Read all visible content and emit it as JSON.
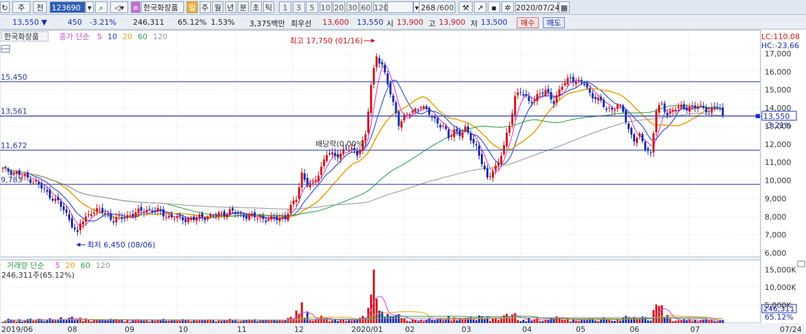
{
  "toolbar": {
    "market": "주",
    "period": "전",
    "code": "123690",
    "stock_name": "한국화장품",
    "periods": [
      "일",
      "주",
      "월",
      "년",
      "분",
      "초",
      "틱"
    ],
    "minutes": [
      "1",
      "3",
      "5",
      "10",
      "20",
      "30",
      "60",
      "120"
    ],
    "count": "268",
    "count_total": "/600",
    "date": "2020/07/24"
  },
  "quote": {
    "price": "13,550",
    "change": "450",
    "change_pct": "-3.21%",
    "volume": "246,311",
    "volume_ratio": "65.12%",
    "turnover": "1.53%",
    "amount": "3,375백만",
    "quote_label": "최우선",
    "ask": "13,600",
    "bid": "13,550",
    "open_label": "시",
    "open": "13,900",
    "high_label": "고",
    "high": "13,900",
    "low_label": "저",
    "low": "13,500",
    "buy_label": "매수",
    "sell_label": "매도"
  },
  "price_panel": {
    "name_tab": "한국화장품",
    "ma_legend": {
      "label": "종가 단순",
      "periods": [
        "5",
        "10",
        "20",
        "60",
        "120"
      ]
    },
    "lc": "LC:110.08",
    "hc": "HC:-23.66",
    "hlines": [
      "15,450",
      "13,561",
      "11,672",
      "9,783"
    ],
    "current_label": "13,550",
    "current_pct": "-3.21%",
    "max_annotation": "최고 17,750 (01/16)",
    "min_annotation": "최저 6,450 (08/06)",
    "dividend_annotation": "배당락(0.00%)"
  },
  "volume_panel": {
    "legend_label": "거래량 단순",
    "legend_periods": [
      "5",
      "20",
      "60",
      "120"
    ],
    "value_label": "246,311주(65.12%)",
    "current_label": "246,311",
    "current_pct": "65.12%"
  },
  "chart_data": {
    "type": "candlestick",
    "x_ticks": [
      "2019/06",
      "08",
      "09",
      "10",
      "11",
      "12",
      "2020/01",
      "02",
      "03",
      "04",
      "05",
      "06",
      "07",
      "07/24"
    ],
    "y_ticks": [
      "6,000",
      "7,000",
      "8,000",
      "9,000",
      "10,000",
      "11,000",
      "12,000",
      "13,000",
      "14,000",
      "15,000",
      "16,000",
      "17,000"
    ],
    "ylim": [
      6000,
      18000
    ],
    "volume_ticks": [
      "5,000K",
      "10,000K",
      "15,000K"
    ],
    "close_anchors": [
      [
        0,
        10600
      ],
      [
        4,
        10450
      ],
      [
        8,
        10200
      ],
      [
        12,
        9900
      ],
      [
        16,
        9300
      ],
      [
        20,
        8800
      ],
      [
        24,
        7900
      ],
      [
        27,
        7000
      ],
      [
        28,
        7600
      ],
      [
        32,
        8300
      ],
      [
        36,
        8300
      ],
      [
        40,
        7800
      ],
      [
        44,
        8000
      ],
      [
        48,
        8200
      ],
      [
        52,
        8400
      ],
      [
        56,
        8300
      ],
      [
        60,
        8000
      ],
      [
        64,
        7900
      ],
      [
        68,
        7850
      ],
      [
        72,
        8000
      ],
      [
        76,
        8050
      ],
      [
        80,
        8200
      ],
      [
        82,
        8300
      ],
      [
        86,
        8100
      ],
      [
        90,
        8000
      ],
      [
        94,
        7900
      ],
      [
        98,
        7850
      ],
      [
        102,
        8000
      ],
      [
        106,
        9000
      ],
      [
        108,
        10400
      ],
      [
        110,
        9800
      ],
      [
        112,
        9700
      ],
      [
        114,
        10400
      ],
      [
        117,
        11500
      ],
      [
        120,
        11300
      ],
      [
        124,
        11800
      ],
      [
        128,
        11500
      ],
      [
        131,
        12500
      ],
      [
        133,
        15200
      ],
      [
        135,
        16900
      ],
      [
        137,
        16400
      ],
      [
        139,
        15300
      ],
      [
        141,
        14200
      ],
      [
        143,
        13200
      ],
      [
        145,
        13500
      ],
      [
        147,
        13700
      ],
      [
        149,
        13900
      ],
      [
        151,
        14200
      ],
      [
        153,
        13800
      ],
      [
        155,
        13500
      ],
      [
        157,
        13200
      ],
      [
        159,
        13000
      ],
      [
        161,
        12300
      ],
      [
        163,
        12800
      ],
      [
        165,
        12600
      ],
      [
        167,
        12800
      ],
      [
        169,
        12300
      ],
      [
        171,
        11900
      ],
      [
        173,
        11000
      ],
      [
        175,
        10000
      ],
      [
        177,
        10600
      ],
      [
        179,
        11000
      ],
      [
        181,
        11900
      ],
      [
        183,
        13000
      ],
      [
        185,
        14700
      ],
      [
        187,
        14900
      ],
      [
        190,
        14300
      ],
      [
        193,
        14700
      ],
      [
        196,
        14900
      ],
      [
        199,
        14400
      ],
      [
        202,
        15200
      ],
      [
        205,
        15700
      ],
      [
        208,
        15400
      ],
      [
        210,
        15300
      ],
      [
        212,
        14800
      ],
      [
        214,
        14600
      ],
      [
        216,
        14300
      ],
      [
        218,
        13900
      ],
      [
        220,
        14000
      ],
      [
        222,
        14100
      ],
      [
        224,
        13800
      ],
      [
        226,
        12800
      ],
      [
        228,
        12300
      ],
      [
        230,
        12400
      ],
      [
        232,
        11800
      ],
      [
        234,
        11500
      ],
      [
        236,
        13900
      ],
      [
        238,
        14100
      ],
      [
        240,
        13700
      ],
      [
        243,
        14000
      ],
      [
        246,
        14000
      ],
      [
        249,
        14100
      ],
      [
        252,
        14000
      ],
      [
        255,
        13900
      ],
      [
        258,
        14100
      ],
      [
        260,
        13550
      ]
    ],
    "max": {
      "label": "최고",
      "value": 17750,
      "date": "01/16"
    },
    "min": {
      "label": "최저",
      "value": 6450,
      "date": "08/06"
    },
    "hlines": [
      15450,
      13561,
      11672,
      9783
    ],
    "current": 13550,
    "moving_averages": [
      "5",
      "10",
      "20",
      "60",
      "120"
    ],
    "colors": {
      "up": "#d0161a",
      "down": "#1b2ca8",
      "ma5": "#d93bd2",
      "ma10": "#2544c9",
      "ma20": "#e6a515",
      "ma60": "#2f9d4a",
      "ma120": "#9a9a9a",
      "hline": "#4a56b8"
    }
  }
}
